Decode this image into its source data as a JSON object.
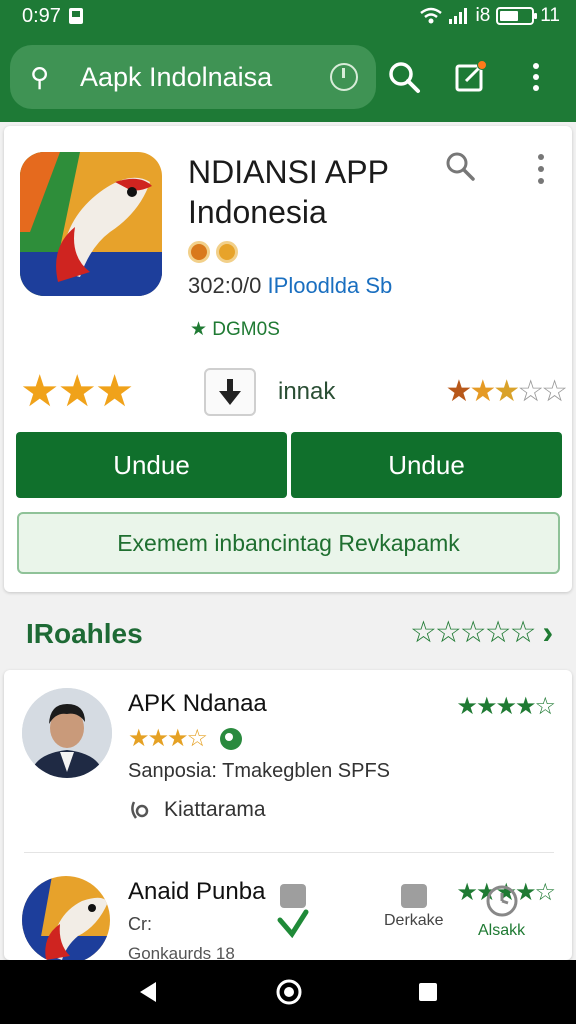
{
  "status_bar": {
    "time": "0:97",
    "signal_text": "Ꭵ8",
    "battery_text": "11",
    "battery_level": 0.6
  },
  "search": {
    "query": "Aapk Indolnaisa"
  },
  "app": {
    "title_line1": "NDIANSI APP",
    "title_line2": "Indonesia",
    "meta_prefix": "302:0/0",
    "meta_link": "IPloodlda Sb",
    "tag": "★ DGM0S",
    "install_label": "innak",
    "rating_gold_stars": 3,
    "rating_small_stars": 5,
    "buttons": [
      "Undue",
      "Undue"
    ],
    "outline_button": "Exemem inbancintag Revkapamk"
  },
  "section": {
    "title": "IRoahles",
    "stars_count": 5
  },
  "reviews": [
    {
      "name": "APK Ndanaa",
      "gold_stars": 4,
      "green_stars": 5,
      "subtitle": "Sanposia: Tmakegblen SPFS",
      "place": "Kiattarama"
    },
    {
      "name": "Anaid Punba",
      "green_stars": 5,
      "subtitle": "Cr:",
      "subtitle2": "Gonkaurds 18"
    }
  ],
  "bottom_nav": {
    "item_right_label": "Derkake",
    "item_far_right_label": "Alsakk"
  },
  "colors": {
    "brand_green": "#1e7a36",
    "button_green": "#10702c",
    "star_gold": "#f0a21a",
    "link_blue": "#1a6fc0"
  }
}
